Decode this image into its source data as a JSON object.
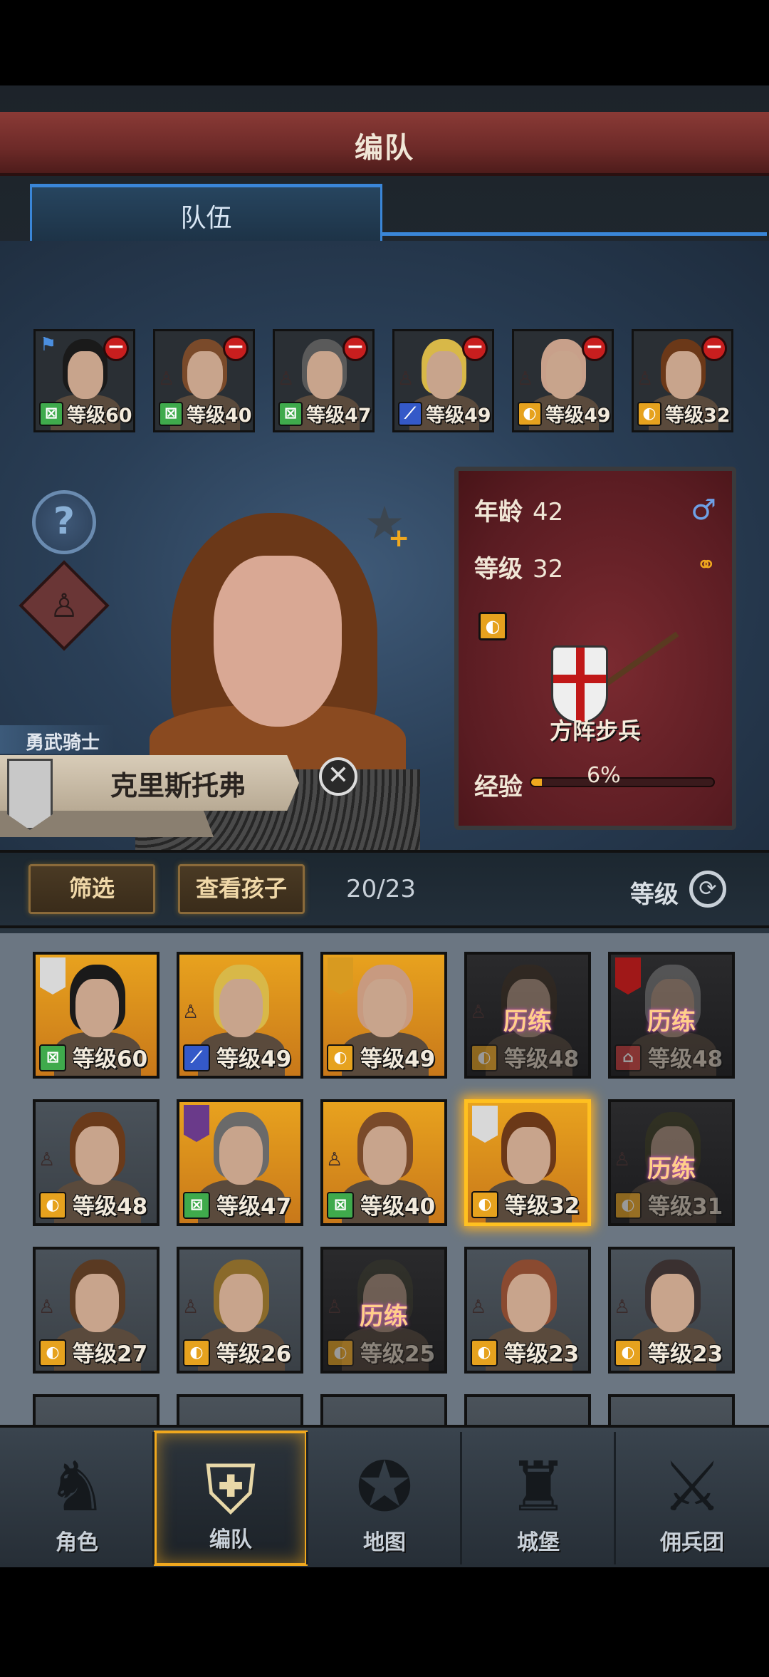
{
  "header": {
    "title": "编队"
  },
  "tabs": [
    {
      "label": "队伍"
    }
  ],
  "team": [
    {
      "level": "等级60",
      "cls": "⊠",
      "color": "green",
      "flag": true
    },
    {
      "level": "等级40",
      "cls": "⊠",
      "color": "green"
    },
    {
      "level": "等级47",
      "cls": "⊠",
      "color": "green"
    },
    {
      "level": "等级49",
      "cls": "⟋",
      "color": "blue"
    },
    {
      "level": "等级49",
      "cls": "◐",
      "color": "gold"
    },
    {
      "level": "等级32",
      "cls": "◐",
      "color": "gold"
    }
  ],
  "unit_card": {
    "age_label": "年龄",
    "age": "42",
    "level_label": "等级",
    "level": "32",
    "unit_type": "方阵步兵",
    "exp_label": "经验",
    "exp_percent_text": "6%",
    "exp_fraction": 0.06
  },
  "hero": {
    "title": "勇武骑士",
    "name": "克里斯托弗"
  },
  "filter_bar": {
    "filter_label": "筛选",
    "children_label": "查看孩子",
    "count": "20/23",
    "sort_label": "等级"
  },
  "roster": [
    {
      "level": "等级60",
      "cls": "⊠",
      "color": "green",
      "bg": "orange",
      "hair": "#1a1a1a",
      "emblem": "#d8d8d8"
    },
    {
      "level": "等级49",
      "cls": "⟋",
      "color": "blue",
      "bg": "orange",
      "hair": "#d8b848"
    },
    {
      "level": "等级49",
      "cls": "◐",
      "color": "gold",
      "bg": "orange",
      "hair": "#c89a80",
      "emblem": "#d89a20"
    },
    {
      "level": "等级48",
      "cls": "◐",
      "color": "gold",
      "bg": "dark",
      "hair": "#3a2a1a",
      "training": "历练"
    },
    {
      "level": "等级48",
      "cls": "⌂",
      "color": "red",
      "bg": "dark",
      "hair": "#8a8a8a",
      "training": "历练",
      "emblem": "#a01818"
    },
    {
      "level": "等级48",
      "cls": "◐",
      "color": "gold",
      "bg": "gray",
      "hair": "#6a3a1a"
    },
    {
      "level": "等级47",
      "cls": "⊠",
      "color": "green",
      "bg": "orange",
      "hair": "#6a6a6a",
      "emblem": "#6a3a8a"
    },
    {
      "level": "等级40",
      "cls": "⊠",
      "color": "green",
      "bg": "orange",
      "hair": "#7a4a2a"
    },
    {
      "level": "等级32",
      "cls": "◐",
      "color": "gold",
      "bg": "orange",
      "hair": "#6b3818",
      "selected": true,
      "emblem": "#d8d8d8"
    },
    {
      "level": "等级31",
      "cls": "◐",
      "color": "gold",
      "bg": "dark",
      "hair": "#3a3a1a",
      "training": "历练"
    },
    {
      "level": "等级27",
      "cls": "◐",
      "color": "gold",
      "bg": "gray",
      "hair": "#5a3a22"
    },
    {
      "level": "等级26",
      "cls": "◐",
      "color": "gold",
      "bg": "gray",
      "hair": "#8a6a2a"
    },
    {
      "level": "等级25",
      "cls": "◐",
      "color": "gold",
      "bg": "dark",
      "hair": "#3a3a2a",
      "training": "历练"
    },
    {
      "level": "等级23",
      "cls": "◐",
      "color": "gold",
      "bg": "gray",
      "hair": "#8a4a30"
    },
    {
      "level": "等级23",
      "cls": "◐",
      "color": "gold",
      "bg": "gray",
      "hair": "#3a3030"
    }
  ],
  "nav": [
    {
      "label": "角色",
      "icon": "knight-icon",
      "glyph": "♞"
    },
    {
      "label": "编队",
      "icon": "helmet-icon",
      "glyph": "⛨",
      "active": true
    },
    {
      "label": "地图",
      "icon": "compass-map-icon",
      "glyph": "✪"
    },
    {
      "label": "城堡",
      "icon": "castle-icon",
      "glyph": "♜"
    },
    {
      "label": "佣兵团",
      "icon": "sword-banner-icon",
      "glyph": "⚔"
    }
  ],
  "colors": {
    "accent": "#f0a81e",
    "tab_blue": "#3a86d8",
    "banner_red": "#8a3a36"
  }
}
